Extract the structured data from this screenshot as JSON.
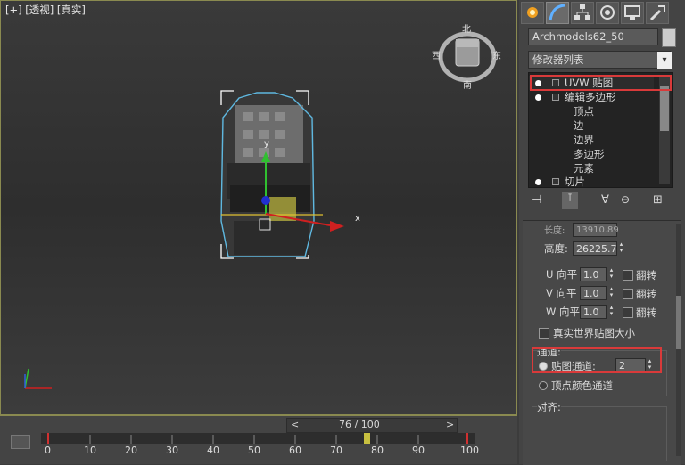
{
  "viewport": {
    "label": "[+] [透视] [真实]",
    "viewcube": {
      "north": "北",
      "south": "南",
      "east": "东",
      "west": "西"
    },
    "axis_x": "x",
    "axis_y": "y"
  },
  "panel": {
    "tabs": [
      "create-tab",
      "modify-tab",
      "hierarchy-tab",
      "motion-tab",
      "display-tab",
      "utilities-tab"
    ],
    "object_name": "Archmodels62_50",
    "modifier_list": "修改器列表",
    "stack": [
      {
        "label": "UVW 贴图",
        "level": 0
      },
      {
        "label": "编辑多边形",
        "level": 0
      },
      {
        "label": "顶点",
        "level": 1
      },
      {
        "label": "边",
        "level": 1
      },
      {
        "label": "边界",
        "level": 1
      },
      {
        "label": "多边形",
        "level": 1
      },
      {
        "label": "元素",
        "level": 1
      },
      {
        "label": "切片",
        "level": 0
      }
    ],
    "params": {
      "length_label": "长度:",
      "length_value": "13910.89",
      "height_label": "高度:",
      "height_value": "26225.7",
      "u_tile_label": "U 向平",
      "u_tile": "1.0",
      "v_tile_label": "V 向平",
      "v_tile": "1.0",
      "w_tile_label": "W 向平",
      "w_tile": "1.0",
      "flip_label": "翻转",
      "real_world": "真实世界贴图大小",
      "channel_group": "通道:",
      "map_channel_label": "贴图通道:",
      "map_channel_value": "2",
      "vertex_color_label": "顶点颜色通道",
      "alignment_group": "对齐:"
    }
  },
  "timeline": {
    "frame_readout": "76 / 100",
    "ticks": [
      "0",
      "10",
      "20",
      "30",
      "40",
      "50",
      "60",
      "70",
      "80",
      "90",
      "100"
    ],
    "prev": "<",
    "next": ">"
  },
  "colors": {
    "highlight": "#d93a3a",
    "selection": "#5fb8e0"
  }
}
